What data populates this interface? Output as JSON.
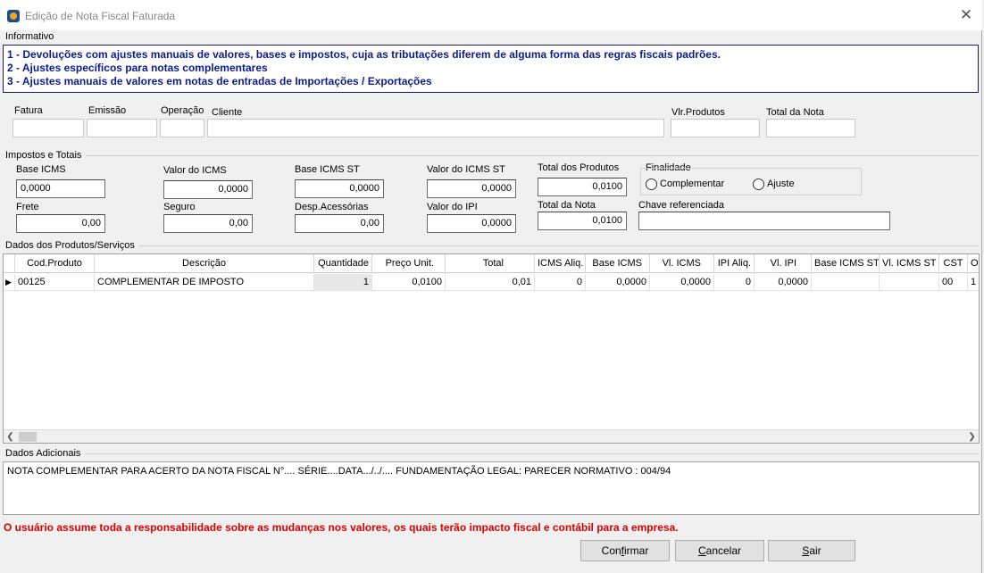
{
  "window": {
    "title": "Edição de Nota Fiscal Faturada",
    "close_glyph": "✕"
  },
  "informativo": {
    "label": "Informativo",
    "lines": [
      "1 - Devoluções com ajustes manuais de valores, bases e impostos, cuja as tributações diferem de alguma forma das regras fiscais padrões.",
      "2 - Ajustes específicos para notas complementares",
      "3 - Ajustes manuais de valores em notas de entradas de Importações / Exportações"
    ]
  },
  "header_fields": {
    "fatura": {
      "label": "Fatura",
      "value": ""
    },
    "emissao": {
      "label": "Emissão",
      "value": ""
    },
    "operacao": {
      "label": "Operação",
      "value": ""
    },
    "cliente": {
      "label": "Cliente",
      "value": ""
    },
    "vlr_produtos": {
      "label": "Vlr.Produtos",
      "value": ""
    },
    "total_nota": {
      "label": "Total da Nota",
      "value": ""
    }
  },
  "impostos": {
    "label": "Impostos e Totais",
    "base_icms": {
      "label": "Base ICMS",
      "value": "0,0000"
    },
    "valor_icms": {
      "label": "Valor do ICMS",
      "value": "0,0000"
    },
    "base_icms_st": {
      "label": "Base ICMS ST",
      "value": "0,0000"
    },
    "valor_icms_st": {
      "label": "Valor do ICMS ST",
      "value": "0,0000"
    },
    "total_produtos": {
      "label": "Total dos Produtos",
      "value": "0,0100"
    },
    "frete": {
      "label": "Frete",
      "value": "0,00"
    },
    "seguro": {
      "label": "Seguro",
      "value": "0,00"
    },
    "desp_acessorias": {
      "label": "Desp.Acessórias",
      "value": "0,00"
    },
    "valor_ipi": {
      "label": "Valor do IPI",
      "value": "0,0000"
    },
    "total_nota": {
      "label": "Total da Nota",
      "value": "0,0100"
    },
    "finalidade": {
      "label": "Finalidade",
      "opt_complementar": "Complementar",
      "opt_ajuste": "Ajuste"
    },
    "chave": {
      "label": "Chave referenciada",
      "value": ""
    }
  },
  "produtos": {
    "label": "Dados dos Produtos/Serviços",
    "columns": [
      "Cod.Produto",
      "Descrição",
      "Quantidade",
      "Preço Unit.",
      "Total",
      "ICMS Aliq.",
      "Base ICMS",
      "Vl. ICMS",
      "IPI Aliq.",
      "Vl. IPI",
      "Base ICMS ST",
      "Vl. ICMS ST",
      "CST",
      "O"
    ],
    "rows": [
      [
        "00125",
        "COMPLEMENTAR DE IMPOSTO",
        "1",
        "0,0100",
        "0,01",
        "0",
        "0,0000",
        "0,0000",
        "0",
        "0,0000",
        "",
        "",
        "00",
        "1"
      ]
    ]
  },
  "adicionais": {
    "label": "Dados Adicionais",
    "text": "NOTA COMPLEMENTAR PARA ACERTO DA NOTA FISCAL N°.... SÉRIE....DATA.../../.... FUNDAMENTAÇÃO LEGAL: PARECER NORMATIVO : 004/94"
  },
  "warning": "O usuário assume toda a responsabilidade sobre as mudanças nos valores, os quais terão impacto fiscal e contábil para a empresa.",
  "buttons": {
    "confirmar": {
      "pre": "Con",
      "u": "f",
      "post": "irmar"
    },
    "cancelar": {
      "pre": "",
      "u": "C",
      "post": "ancelar"
    },
    "sair": {
      "pre": "",
      "u": "S",
      "post": "air"
    }
  }
}
